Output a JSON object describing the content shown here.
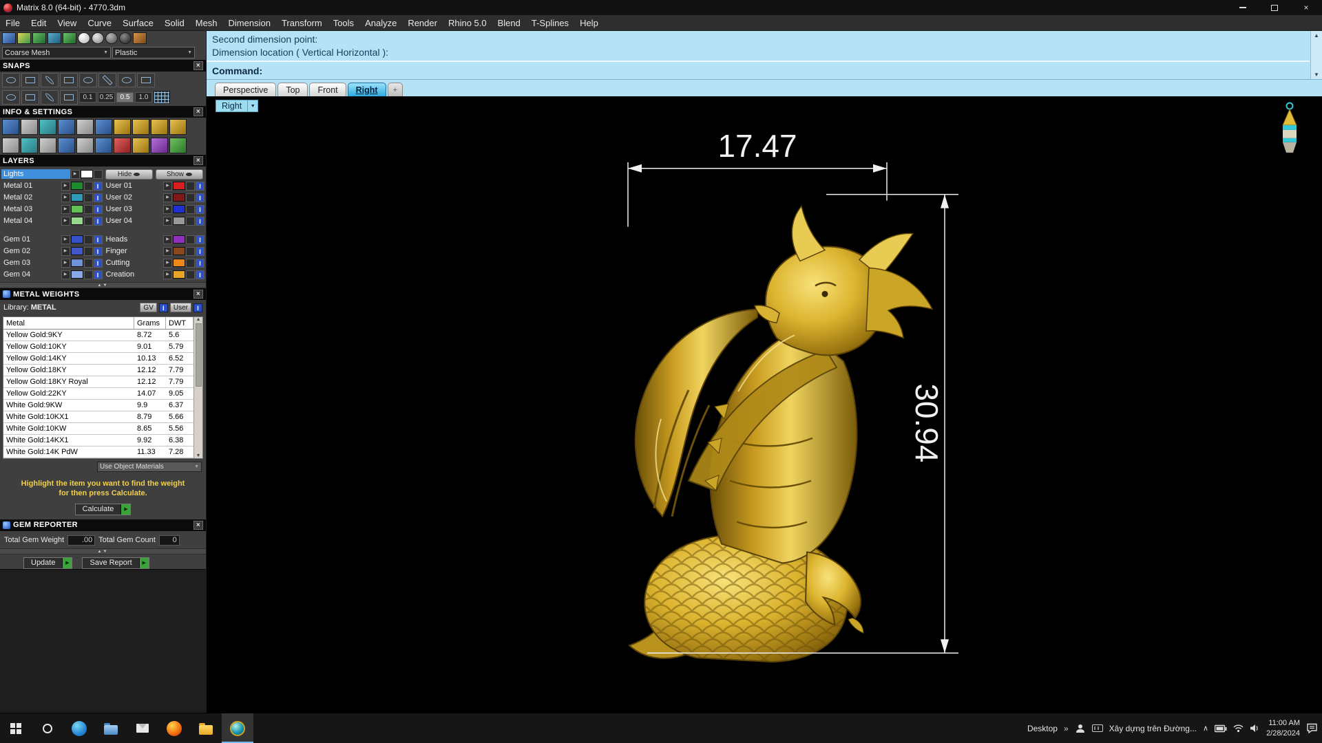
{
  "window": {
    "title": "Matrix 8.0 (64-bit) - 4770.3dm",
    "menu": [
      "File",
      "Edit",
      "View",
      "Curve",
      "Surface",
      "Solid",
      "Mesh",
      "Dimension",
      "Transform",
      "Tools",
      "Analyze",
      "Render",
      "Rhino 5.0",
      "Blend",
      "T-Splines",
      "Help"
    ]
  },
  "display_bar": {
    "mesh_mode": "Coarse Mesh",
    "material_mode": "Plastic"
  },
  "snaps": {
    "title": "SNAPS",
    "grid_values": [
      "0.1",
      "0.25",
      "0.5",
      "1.0"
    ],
    "active_grid_value": "0.5"
  },
  "info_settings": {
    "title": "INFO & SETTINGS"
  },
  "layers": {
    "title": "LAYERS",
    "lights": {
      "label": "Lights"
    },
    "hide_label": "Hide",
    "show_label": "Show",
    "left_rows": [
      {
        "label": "Metal 01",
        "color": "#1e8a2e"
      },
      {
        "label": "Metal 02",
        "color": "#2e9ab8"
      },
      {
        "label": "Metal 03",
        "color": "#66c05a"
      },
      {
        "label": "Metal 04",
        "color": "#98d88e"
      },
      {
        "label": "Gem 01",
        "color": "#3850c8"
      },
      {
        "label": "Gem 02",
        "color": "#4058c8"
      },
      {
        "label": "Gem 03",
        "color": "#7090dc"
      },
      {
        "label": "Gem 04",
        "color": "#88a8e8"
      }
    ],
    "right_rows": [
      {
        "label": "User 01",
        "color": "#d82020"
      },
      {
        "label": "User 02",
        "color": "#801818"
      },
      {
        "label": "User 03",
        "color": "#2030d0"
      },
      {
        "label": "User 04",
        "color": "#989898"
      },
      {
        "label": "Heads",
        "color": "#9030c0"
      },
      {
        "label": "Finger",
        "color": "#8a4820"
      },
      {
        "label": "Cutting",
        "color": "#f08818"
      },
      {
        "label": "Creation",
        "color": "#e8a428"
      }
    ]
  },
  "metal_weights": {
    "title": "METAL WEIGHTS",
    "library_label": "Library:",
    "library_value": "METAL",
    "gv_label": "GV",
    "user_label": "User",
    "columns": [
      "Metal",
      "Grams",
      "DWT"
    ],
    "rows": [
      [
        "Yellow Gold:9KY",
        "8.72",
        "5.6"
      ],
      [
        "Yellow Gold:10KY",
        "9.01",
        "5.79"
      ],
      [
        "Yellow Gold:14KY",
        "10.13",
        "6.52"
      ],
      [
        "Yellow Gold:18KY",
        "12.12",
        "7.79"
      ],
      [
        "Yellow Gold:18KY Royal",
        "12.12",
        "7.79"
      ],
      [
        "Yellow Gold:22KY",
        "14.07",
        "9.05"
      ],
      [
        "White Gold:9KW",
        "9.9",
        "6.37"
      ],
      [
        "White Gold:10KX1",
        "8.79",
        "5.66"
      ],
      [
        "White Gold:10KW",
        "8.65",
        "5.56"
      ],
      [
        "White Gold:14KX1",
        "9.92",
        "6.38"
      ],
      [
        "White Gold:14K PdW",
        "11.33",
        "7.28"
      ]
    ],
    "materials_dropdown": "Use Object Materials",
    "instruction_line1": "Highlight the item you want to find the weight",
    "instruction_line2": "for then press Calculate.",
    "calculate_label": "Calculate"
  },
  "gem_reporter": {
    "title": "GEM REPORTER",
    "total_weight_label": "Total Gem Weight",
    "total_weight_value": ".00",
    "total_count_label": "Total Gem Count",
    "total_count_value": "0",
    "update_label": "Update",
    "save_report_label": "Save Report"
  },
  "command_area": {
    "history_line1": "Second dimension point:",
    "history_line2": "Dimension location ( Vertical  Horizontal ):",
    "prompt_label": "Command:"
  },
  "viewport": {
    "tabs": [
      "Perspective",
      "Top",
      "Front",
      "Right"
    ],
    "active_tab": "Right",
    "view_label": "Right",
    "dimensions": {
      "width": "17.47",
      "height": "30.94"
    }
  },
  "taskbar": {
    "desktop_label": "Desktop",
    "ime_status": "Xây dựng trên Đường...",
    "clock": {
      "time": "11:00 AM",
      "date": "2/28/2024"
    }
  },
  "icons": {
    "close_x": "×",
    "dropdown_arrow": "▼",
    "expand_arrow": "▶",
    "scroll_up": "▲",
    "scroll_down": "▼",
    "splitter": "▲▼",
    "plus": "+",
    "chevrons_right": "»",
    "chevron_up": "∧",
    "play": "▶",
    "info": "I"
  },
  "colors": {
    "gold": "#d9b437",
    "command_bg": "#b5e2f4",
    "highlight_blue": "#3f8fdc"
  }
}
